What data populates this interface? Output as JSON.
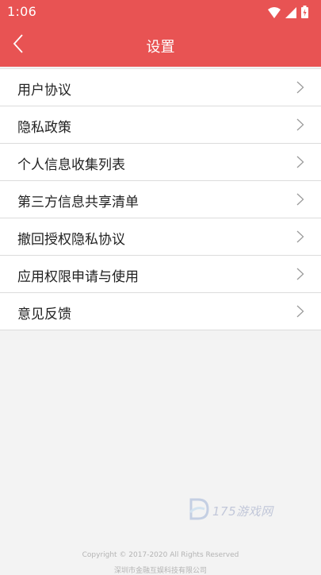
{
  "status_bar": {
    "time": "1:06",
    "icons": [
      "wifi-icon",
      "signal-icon",
      "battery-icon"
    ]
  },
  "header": {
    "title": "设置",
    "back_icon": "chevron-left-icon"
  },
  "menu": {
    "items": [
      {
        "label": "用户协议"
      },
      {
        "label": "隐私政策"
      },
      {
        "label": "个人信息收集列表"
      },
      {
        "label": "第三方信息共享清单"
      },
      {
        "label": "撤回授权隐私协议"
      },
      {
        "label": "应用权限申请与使用"
      },
      {
        "label": "意见反馈"
      }
    ]
  },
  "watermark": {
    "text": "175游戏网"
  },
  "footer": {
    "copyright": "Copyright © 2017-2020 All Rights Reserved",
    "company": "深圳市金融互娱科技有限公司"
  },
  "colors": {
    "accent": "#e85353",
    "background": "#f3f3f3"
  }
}
